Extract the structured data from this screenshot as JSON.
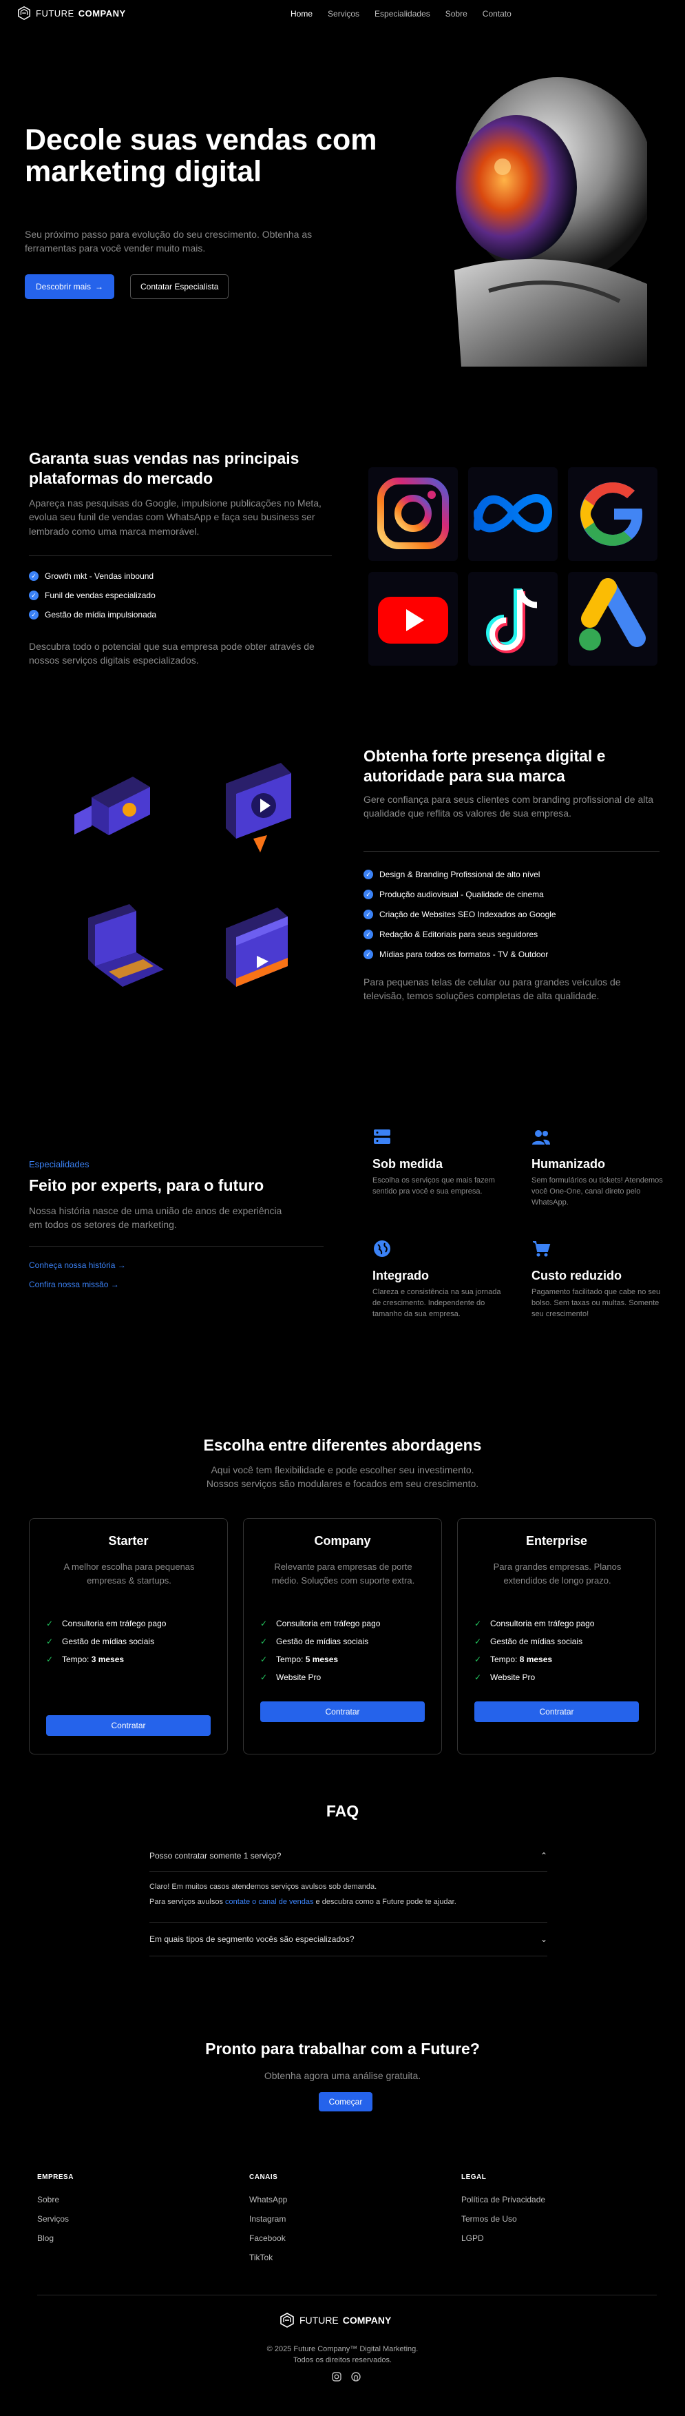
{
  "nav": {
    "brand_light": "FUTURE",
    "brand_bold": "COMPANY",
    "links": [
      "Home",
      "Serviços",
      "Especialidades",
      "Sobre",
      "Contato"
    ]
  },
  "hero": {
    "title": "Decole suas vendas com marketing digital",
    "subtitle": "Seu próximo passo para evolução do seu crescimento. Obtenha as ferramentas para você vender muito mais.",
    "primary_cta": "Descobrir mais",
    "secondary_cta": "Contatar Especialista"
  },
  "platforms": {
    "title": "Garanta suas vendas nas principais plataformas do mercado",
    "subtitle": "Apareça nas pesquisas do Google, impulsione publicações no Meta, evolua seu funil de vendas com WhatsApp e faça seu business ser lembrado como uma marca memorável.",
    "items": [
      "Growth mkt - Vendas inbound",
      "Funil de vendas especializado",
      "Gestão de mídia impulsionada"
    ],
    "footer": "Descubra todo o potencial que sua empresa pode obter através de nossos serviços digitais especializados.",
    "icons": [
      "instagram-icon",
      "meta-icon",
      "google-icon",
      "youtube-icon",
      "tiktok-icon",
      "google-ads-icon"
    ]
  },
  "presence": {
    "title": "Obtenha forte presença digital e autoridade para sua marca",
    "subtitle": "Gere confiança para seus clientes com branding profissional de alta qualidade que reflita os valores de sua empresa.",
    "items": [
      "Design & Branding Profissional de alto nível",
      "Produção audiovisual - Qualidade de cinema",
      "Criação de Websites SEO Indexados ao Google",
      "Redação & Editoriais para seus seguidores",
      "Mídias para todos os formatos - TV & Outdoor"
    ],
    "footer": "Para pequenas telas de celular ou para grandes veículos de televisão, temos soluções completas de alta qualidade."
  },
  "experts": {
    "eyebrow": "Especialidades",
    "title": "Feito por experts, para o futuro",
    "subtitle": "Nossa história nasce de uma união de anos de experiência em todos os setores de marketing.",
    "link_history": "Conheça nossa história",
    "link_mission": "Confira nossa missão",
    "features": [
      {
        "title": "Sob medida",
        "text": "Escolha os serviços que mais fazem sentido pra você e sua empresa."
      },
      {
        "title": "Humanizado",
        "text": "Sem formulários ou tickets! Atendemos você One-One, canal direto pelo WhatsApp."
      },
      {
        "title": "Integrado",
        "text": "Clareza e consistência na sua jornada de crescimento. Independente do tamanho da sua empresa."
      },
      {
        "title": "Custo reduzido",
        "text": "Pagamento facilitado que cabe no seu bolso. Sem taxas ou multas. Somente seu crescimento!"
      }
    ]
  },
  "pricing": {
    "title": "Escolha entre diferentes abordagens",
    "subtitle_line1": "Aqui você tem flexibilidade e pode escolher seu investimento.",
    "subtitle_line2": "Nossos serviços são modulares e focados em seu crescimento.",
    "plans": [
      {
        "name": "Starter",
        "desc": "A melhor escolha para pequenas empresas & startups.",
        "f1": "Consultoria em tráfego pago",
        "f2": "Gestão de mídias sociais",
        "time_label": "Tempo: ",
        "time_value": "3 meses",
        "f4": "",
        "cta": "Contratar"
      },
      {
        "name": "Company",
        "desc": "Relevante para empresas de porte médio. Soluções com suporte extra.",
        "f1": "Consultoria em tráfego pago",
        "f2": "Gestão de mídias sociais",
        "time_label": "Tempo: ",
        "time_value": "5 meses",
        "f4": "Website Pro",
        "cta": "Contratar"
      },
      {
        "name": "Enterprise",
        "desc": "Para grandes empresas. Planos extendidos de longo prazo.",
        "f1": "Consultoria em tráfego pago",
        "f2": "Gestão de mídias sociais",
        "time_label": "Tempo: ",
        "time_value": "8 meses",
        "f4": "Website Pro",
        "cta": "Contratar"
      }
    ]
  },
  "faq": {
    "title": "FAQ",
    "q1": "Posso contratar somente 1 serviço?",
    "a1_line1": "Claro! Em muitos casos atendemos serviços avulsos sob demanda.",
    "a1_pre": "Para serviços avulsos ",
    "a1_link": "contate o canal de vendas",
    "a1_post": " e descubra como a Future pode te ajudar.",
    "q2": "Em quais tipos de segmento vocês são especializados?"
  },
  "cta": {
    "title": "Pronto para trabalhar com a Future?",
    "subtitle": "Obtenha agora uma análise gratuita.",
    "button": "Começar"
  },
  "footer": {
    "col1_title": "EMPRESA",
    "col1": [
      "Sobre",
      "Serviços",
      "Blog"
    ],
    "col2_title": "CANAIS",
    "col2": [
      "WhatsApp",
      "Instagram",
      "Facebook",
      "TikTok"
    ],
    "col3_title": "LEGAL",
    "col3": [
      "Política de Privacidade",
      "Termos de Uso",
      "LGPD"
    ],
    "copy_line1": "© 2025 Future Company™ Digital Marketing.",
    "copy_line2": "Todos os direitos reservados."
  },
  "colors": {
    "accent": "#2563eb",
    "link": "#3b82f6",
    "check_green": "#22c55e",
    "background": "#000000"
  }
}
